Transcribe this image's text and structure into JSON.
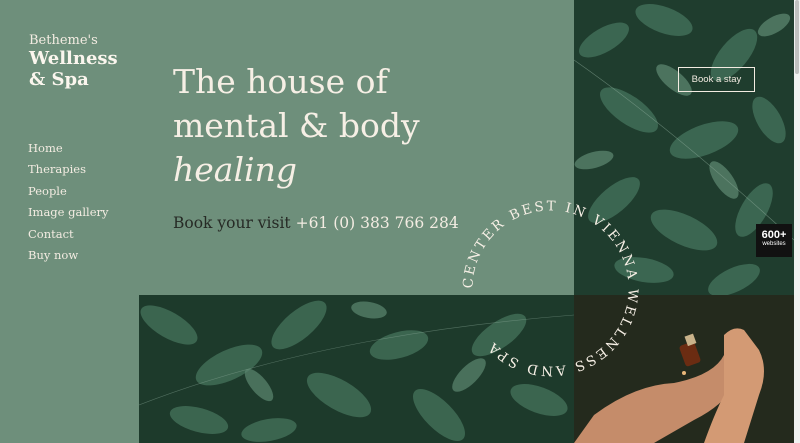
{
  "logo": {
    "line1": "Betheme's",
    "line2": "Wellness",
    "line3": "& Spa"
  },
  "nav": {
    "items": [
      "Home",
      "Therapies",
      "People",
      "Image gallery",
      "Contact",
      "Buy now"
    ]
  },
  "hero": {
    "line1": "The house of",
    "line2": "mental & body",
    "line3": "healing",
    "visit_label": "Book your visit",
    "phone": "+61 (0) 383 766 284"
  },
  "cta": {
    "book_label": "Book a stay"
  },
  "badge": {
    "count": "600+",
    "label": "websites"
  },
  "circle_text": "CENTER BEST IN VIENNA WELLNESS AND SPA ",
  "colors": {
    "sage": "#6e8f7b",
    "cream": "#f3ece2",
    "dark_green": "#1d3b2c"
  }
}
